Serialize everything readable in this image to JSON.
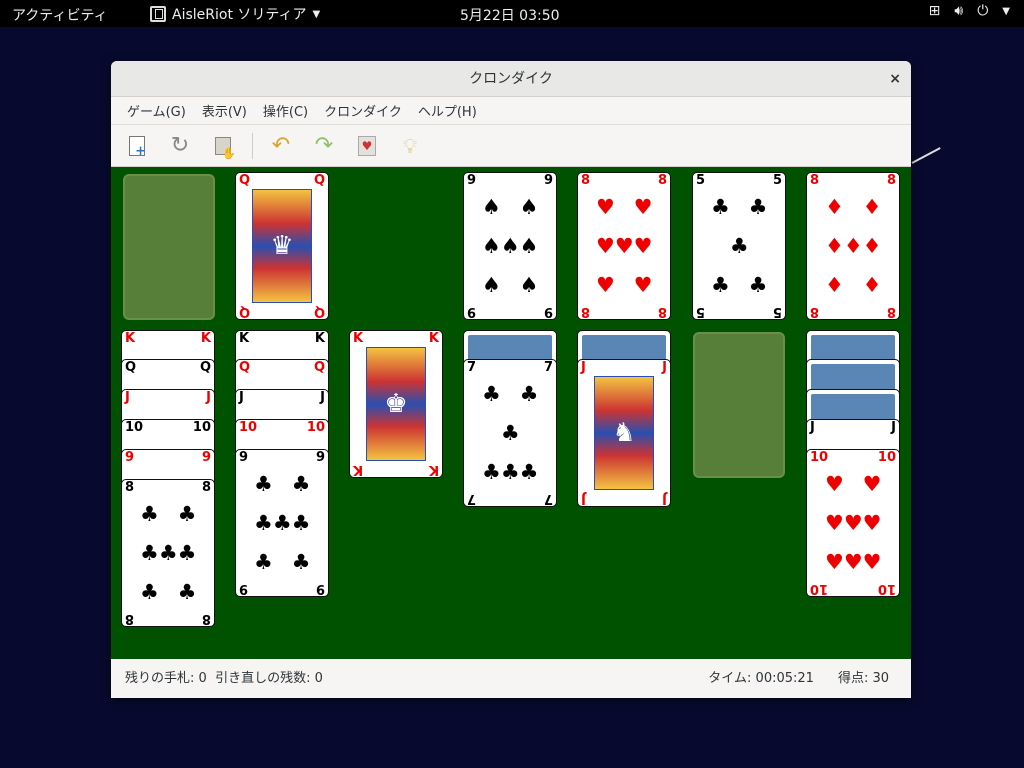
{
  "topbar": {
    "activities": "アクティビティ",
    "app_name": "AisleRiot ソリティア",
    "clock": "5月22日  03:50"
  },
  "window": {
    "title": "クロンダイク",
    "close": "×"
  },
  "menu": {
    "game": "ゲーム(G)",
    "view": "表示(V)",
    "control": "操作(C)",
    "klondike": "クロンダイク",
    "help": "ヘルプ(H)"
  },
  "icons": {
    "new": "new-game-icon",
    "restart": "restart-icon",
    "deal": "deal-icon",
    "undo": "undo-icon",
    "redo": "redo-icon",
    "hint2": "select-game-icon",
    "hint": "hint-icon"
  },
  "status": {
    "stock": "残りの手札: 0",
    "redeals": "引き直しの残数: 0",
    "time": "タイム: 00:05:21",
    "score": "得点:   30"
  },
  "colors": {
    "felt": "#005200",
    "desktop": "#070a2e"
  }
}
